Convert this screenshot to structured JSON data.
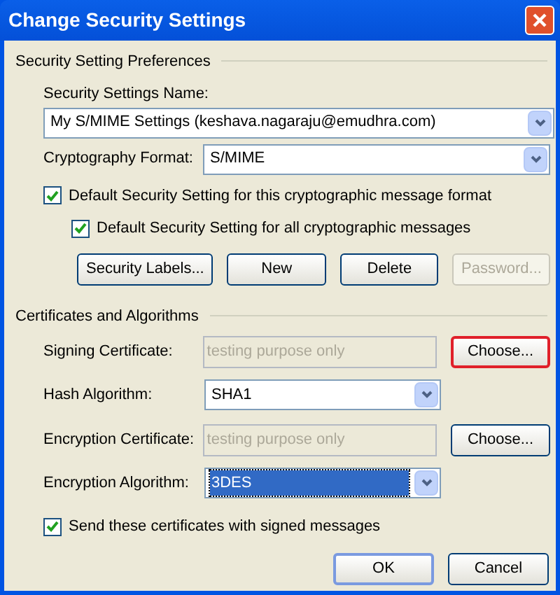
{
  "window": {
    "title": "Change Security Settings"
  },
  "preferences": {
    "title": "Security Setting Preferences",
    "name_label": "Security Settings Name:",
    "name_value": "My S/MIME Settings (keshava.nagaraju@emudhra.com)",
    "format_label": "Cryptography Format:",
    "format_value": "S/MIME",
    "checkboxes": [
      {
        "label": "Default Security Setting for this cryptographic message format",
        "checked": true
      },
      {
        "label": "Default Security Setting for all cryptographic messages",
        "checked": true
      }
    ],
    "buttons": [
      {
        "label": "Security Labels...",
        "disabled": false
      },
      {
        "label": "New",
        "disabled": false
      },
      {
        "label": "Delete",
        "disabled": false
      },
      {
        "label": "Password...",
        "disabled": true
      }
    ]
  },
  "certificates": {
    "title": "Certificates and Algorithms",
    "rows": [
      {
        "kind": "field",
        "label": "Signing Certificate:",
        "value": "testing purpose only",
        "disabled": true,
        "button": {
          "label": "Choose...",
          "focused": true
        }
      },
      {
        "kind": "combo",
        "label": "Hash Algorithm:",
        "value": "SHA1",
        "highlighted": false
      },
      {
        "kind": "field",
        "label": "Encryption Certificate:",
        "value": "testing purpose only",
        "disabled": true,
        "button": {
          "label": "Choose...",
          "focused": false
        }
      },
      {
        "kind": "combo",
        "label": "Encryption Algorithm:",
        "value": "3DES",
        "highlighted": true
      }
    ],
    "checkbox": {
      "label": "Send these certificates with signed messages",
      "checked": true
    }
  },
  "footer_buttons": [
    {
      "label": "OK",
      "default": true
    },
    {
      "label": "Cancel",
      "default": false
    }
  ]
}
